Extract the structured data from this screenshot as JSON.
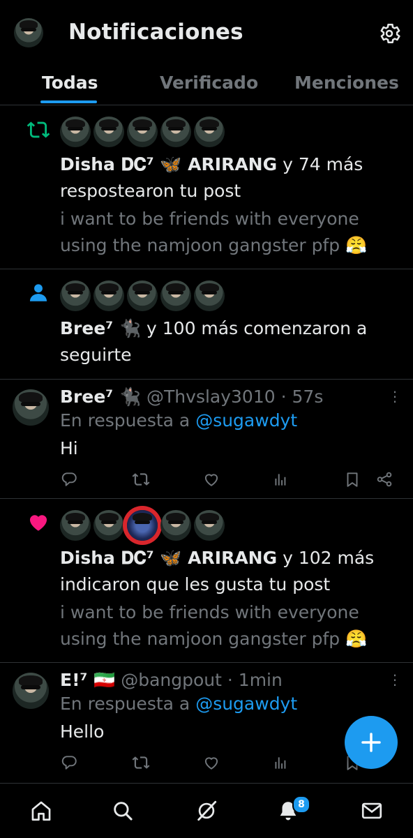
{
  "header": {
    "title": "Notificaciones"
  },
  "tabs": [
    {
      "label": "Todas",
      "active": true
    },
    {
      "label": "Verificado",
      "active": false
    },
    {
      "label": "Menciones",
      "active": false
    }
  ],
  "notifications": [
    {
      "type": "repost",
      "icon": "repost-icon",
      "names": "Disha 𝐃𝐂⁷ 🦋 ARIRANG",
      "suffix": " y 74 más",
      "action": "respostearon tu post",
      "post_text": "i want to be friends with everyone using the namjoon gangster pfp 😤"
    },
    {
      "type": "follow",
      "icon": "person-icon",
      "names": "Bree⁷ 🐈‍⬛",
      "suffix": " y 100 más comenzaron a seguirte"
    },
    {
      "type": "reply",
      "name": "Bree⁷ 🐈‍⬛",
      "handle": "@Thvslay3010",
      "time": "· 57s",
      "reply_prefix": "En respuesta a ",
      "reply_to": "@sugawdyt",
      "body": "Hi"
    },
    {
      "type": "like",
      "icon": "heart-icon",
      "names": "Disha 𝐃𝐂⁷ 🦋 ARIRANG",
      "suffix": " y 102 más",
      "action": "indicaron que les gusta tu post",
      "post_text": "i want to be friends with everyone using the namjoon gangster pfp 😤"
    },
    {
      "type": "reply",
      "name": "E!⁷ 🇮🇷",
      "handle": "@bangpout",
      "time": "· 1min",
      "reply_prefix": "En respuesta a ",
      "reply_to": "@sugawdyt",
      "body": "Hello"
    }
  ],
  "bottom_nav": {
    "items": [
      "home-icon",
      "search-icon",
      "grok-icon",
      "bell-icon",
      "mail-icon"
    ],
    "notification_count": "8"
  },
  "colors": {
    "accent": "#1d9bf0",
    "repost": "#00ba7c",
    "like": "#f91880",
    "background": "#000000"
  }
}
